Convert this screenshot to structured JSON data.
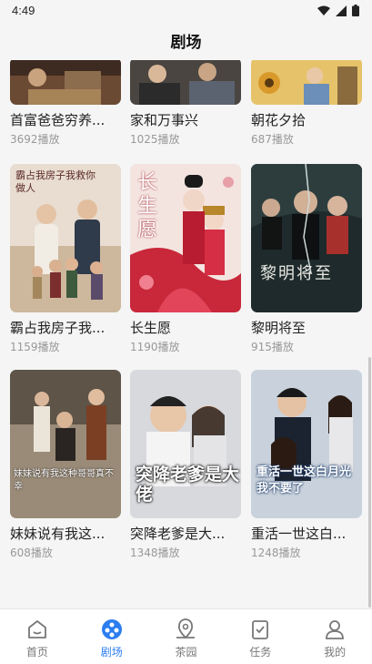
{
  "status": {
    "time": "4:49"
  },
  "header": {
    "title": "剧场"
  },
  "dramas": [
    {
      "title": "首富爸爸穷养...",
      "plays": "3692播放",
      "overlay": ""
    },
    {
      "title": "家和万事兴",
      "plays": "1025播放",
      "overlay": ""
    },
    {
      "title": "朝花夕拾",
      "plays": "687播放",
      "overlay": ""
    },
    {
      "title": "霸占我房子我...",
      "plays": "1159播放",
      "overlay": "霸占我房子我救你做人"
    },
    {
      "title": "长生愿",
      "plays": "1190播放",
      "overlay": "长生愿"
    },
    {
      "title": "黎明将至",
      "plays": "915播放",
      "overlay": "黎明将至"
    },
    {
      "title": "妹妹说有我这...",
      "plays": "608播放",
      "overlay": "妹妹说有我这种哥哥真不幸"
    },
    {
      "title": "突降老爹是大...",
      "plays": "1348播放",
      "overlay": "突降老爹是大佬"
    },
    {
      "title": "重活一世这白...",
      "plays": "1248播放",
      "overlay": "重活一世这白月光我不要了"
    }
  ],
  "tabbar": [
    {
      "label": "首页",
      "icon": "home-icon",
      "active": false
    },
    {
      "label": "剧场",
      "icon": "film-reel-icon",
      "active": true
    },
    {
      "label": "茶园",
      "icon": "map-pin-icon",
      "active": false
    },
    {
      "label": "任务",
      "icon": "task-check-icon",
      "active": false
    },
    {
      "label": "我的",
      "icon": "user-icon",
      "active": false
    }
  ],
  "colors": {
    "accent": "#2c7ef0",
    "background": "#f5f5f5"
  }
}
